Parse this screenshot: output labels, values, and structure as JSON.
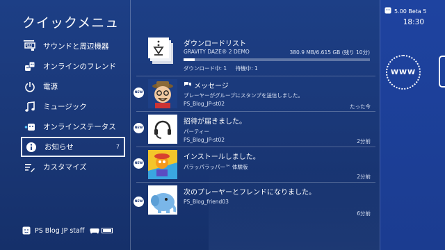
{
  "header": {
    "title": "クイックメニュー"
  },
  "menu": [
    {
      "label": "サウンドと周辺機器",
      "icon": "keyboard-icon"
    },
    {
      "label": "オンラインのフレンド",
      "icon": "friends-icon"
    },
    {
      "label": "電源",
      "icon": "power-icon"
    },
    {
      "label": "ミュージック",
      "icon": "music-note-icon"
    },
    {
      "label": "オンラインステータス",
      "icon": "online-status-icon"
    },
    {
      "label": "お知らせ",
      "icon": "info-icon",
      "badge": "7"
    },
    {
      "label": "カスタマイズ",
      "icon": "customize-icon"
    }
  ],
  "user": {
    "name": "PS Blog JP staff"
  },
  "notifications": [
    {
      "title": "ダウンロードリスト",
      "sub1": "GRAVITY DAZE® 2 DEMO",
      "size": "380.9 MB/6.615 GB (残り 10分)",
      "status_downloading": "ダウンロード中: 1",
      "status_waiting": "待機中: 1",
      "progress": 0.058
    },
    {
      "badge": "NEW",
      "title": "メッセージ",
      "sub1": "プレーヤーがグループにスタンプを送信しました。",
      "sub2": "PS_Blog_JP-st02",
      "time": "たった今"
    },
    {
      "badge": "NEW",
      "title": "招待が届きました。",
      "sub1": "パーティー",
      "sub2": "PS_Blog_JP-st02",
      "time": "2分前"
    },
    {
      "badge": "NEW",
      "title": "インストールしました。",
      "sub1": "パラッパラッパー™ 体験版",
      "time": "2分前"
    },
    {
      "badge": "NEW",
      "title": "次のプレーヤーとフレンドになりました。",
      "sub1": "PS_Blog_friend03",
      "time": "6分前"
    }
  ],
  "system": {
    "version": "5.00 Beta 5",
    "time": "18:30"
  },
  "browser": {
    "label": "WWW"
  },
  "colors": {
    "background": "#1d3f86",
    "accent": "#1e43a0"
  }
}
